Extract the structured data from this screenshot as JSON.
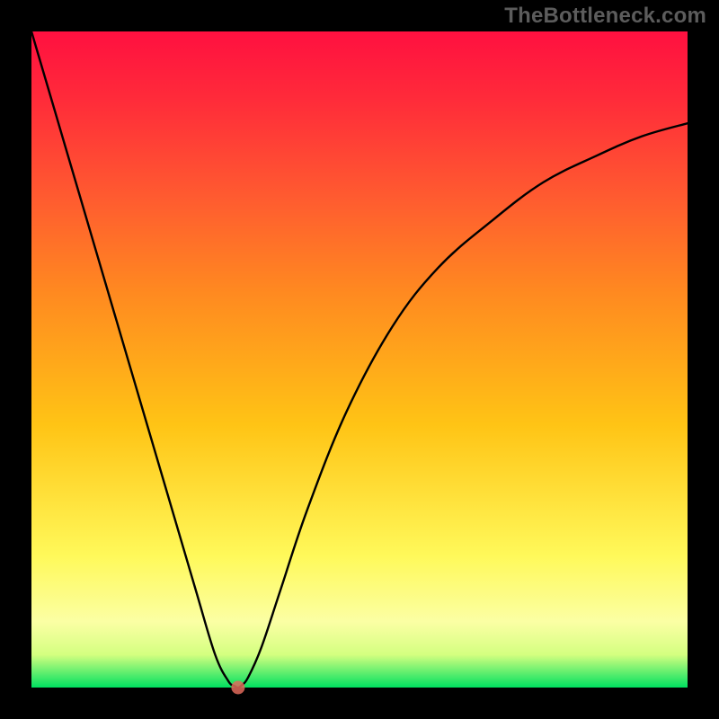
{
  "watermark": "TheBottleneck.com",
  "chart_data": {
    "type": "line",
    "title": "",
    "xlabel": "",
    "ylabel": "",
    "xlim": [
      0,
      100
    ],
    "ylim": [
      0,
      100
    ],
    "x": [
      0,
      5,
      10,
      15,
      20,
      25,
      28,
      30,
      31,
      31.5,
      32,
      33,
      35,
      38,
      42,
      48,
      55,
      62,
      70,
      78,
      86,
      93,
      100
    ],
    "values": [
      100,
      83,
      66,
      49,
      32,
      15,
      5,
      1,
      0.2,
      0,
      0.3,
      1.5,
      6,
      15,
      27,
      42,
      55,
      64,
      71,
      77,
      81,
      84,
      86
    ],
    "marker": {
      "x": 31.5,
      "y": 0
    },
    "colors": {
      "top": "#ff1040",
      "mid_upper": "#ff8a20",
      "mid": "#ffc415",
      "mid_lower": "#fff95a",
      "bottom": "#00e060",
      "curve": "#000000",
      "marker": "#e06a5a",
      "background": "#000000"
    }
  }
}
